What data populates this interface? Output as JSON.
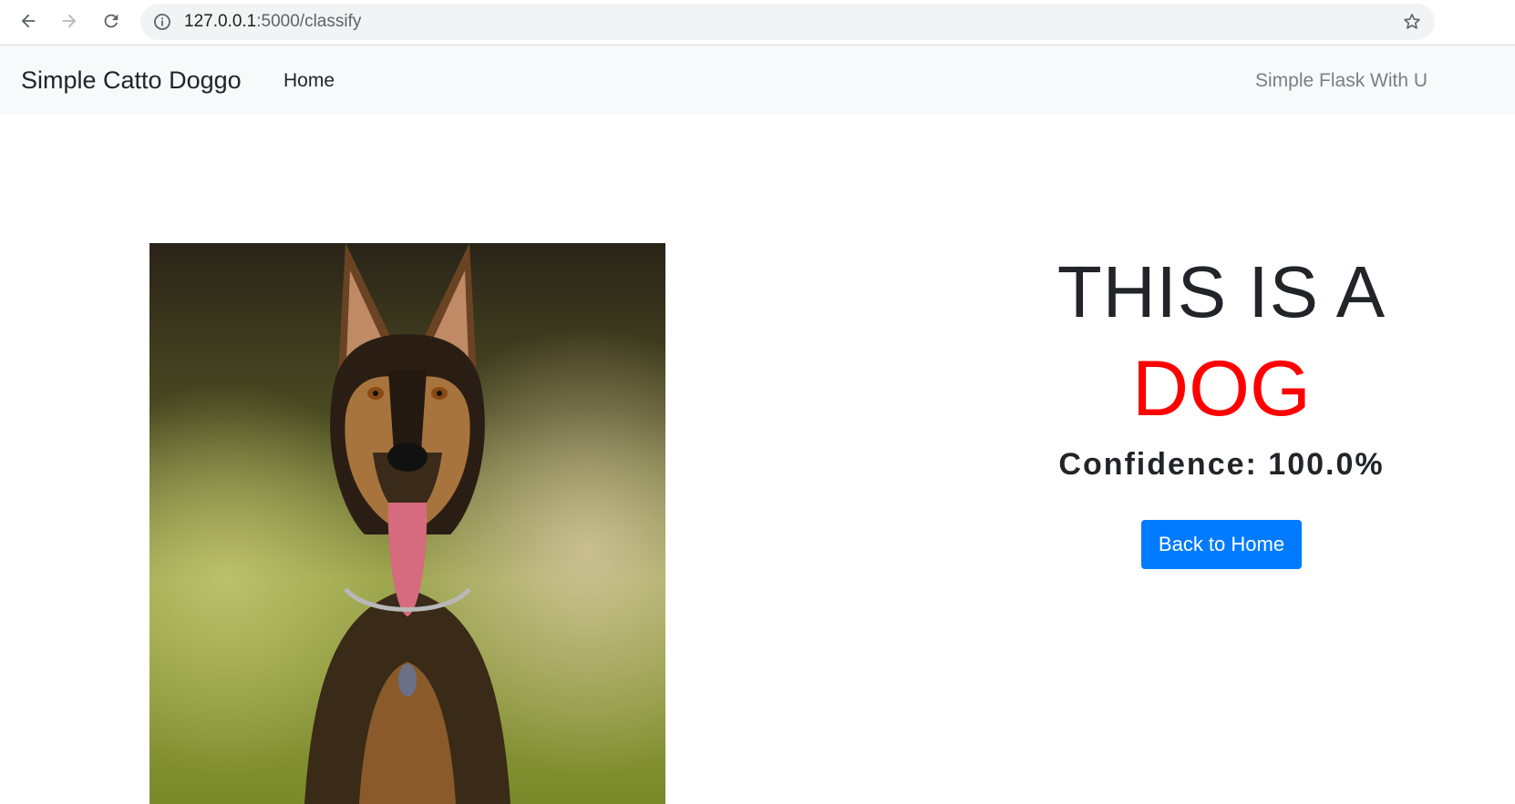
{
  "browser": {
    "url_host": "127.0.0.1",
    "url_rest": ":5000/classify",
    "icons": [
      "back-arrow-icon",
      "forward-arrow-icon",
      "reload-icon",
      "info-icon",
      "star-icon"
    ]
  },
  "navbar": {
    "brand": "Simple Catto Doggo",
    "home": "Home",
    "right_text": "Simple Flask With U"
  },
  "result": {
    "headline": "THIS IS A",
    "label": "DOG",
    "confidence": "Confidence: 100.0%",
    "button": "Back to Home"
  },
  "colors": {
    "label": "#ff0000",
    "button": "#007bff",
    "navbar_bg": "#f8f9fa"
  }
}
